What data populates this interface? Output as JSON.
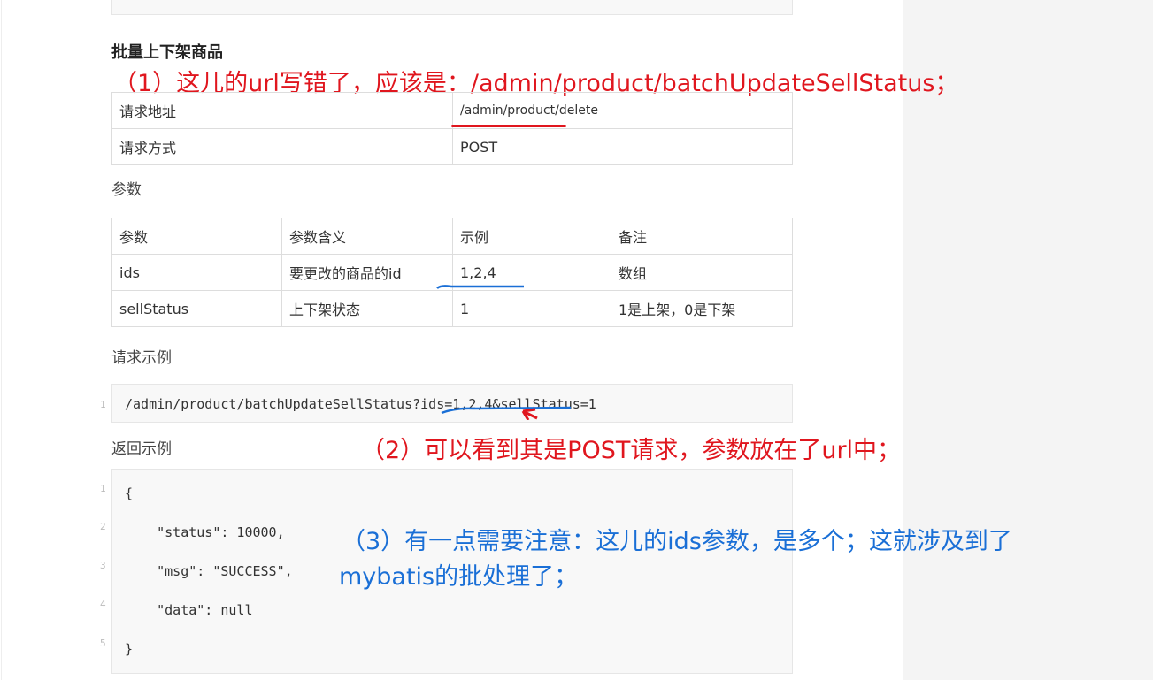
{
  "heading": "批量上下架商品",
  "annotations": {
    "a1": "（1）这儿的url写错了，应该是：/admin/product/batchUpdateSellStatus；",
    "a2": "（2）可以看到其是POST请求，参数放在了url中；",
    "a3_line1": "（3）有一点需要注意：这儿的ids参数，是多个；这就涉及到了",
    "a3_line2": "mybatis的批处理了；"
  },
  "request_table": [
    [
      "请求地址",
      "/admin/product/delete"
    ],
    [
      "请求方式",
      "POST"
    ]
  ],
  "params_label": "参数",
  "params_table": [
    [
      "参数",
      "参数含义",
      "示例",
      "备注"
    ],
    [
      "ids",
      "要更改的商品的id",
      "1,2,4",
      "数组"
    ],
    [
      "sellStatus",
      "上下架状态",
      "1",
      "1是上架，0是下架"
    ]
  ],
  "request_example_label": "请求示例",
  "request_example": "/admin/product/batchUpdateSellStatus?ids=1,2,4&sellStatus=1",
  "response_example_label": "返回示例",
  "response_lines": [
    "{",
    "    \"status\": 10000,",
    "    \"msg\": \"SUCCESS\",",
    "    \"data\": null",
    "}"
  ],
  "line_numbers": [
    "1",
    "2",
    "3",
    "4",
    "5"
  ],
  "colors": {
    "red": "#e0161e",
    "blue": "#1a6fd6"
  }
}
